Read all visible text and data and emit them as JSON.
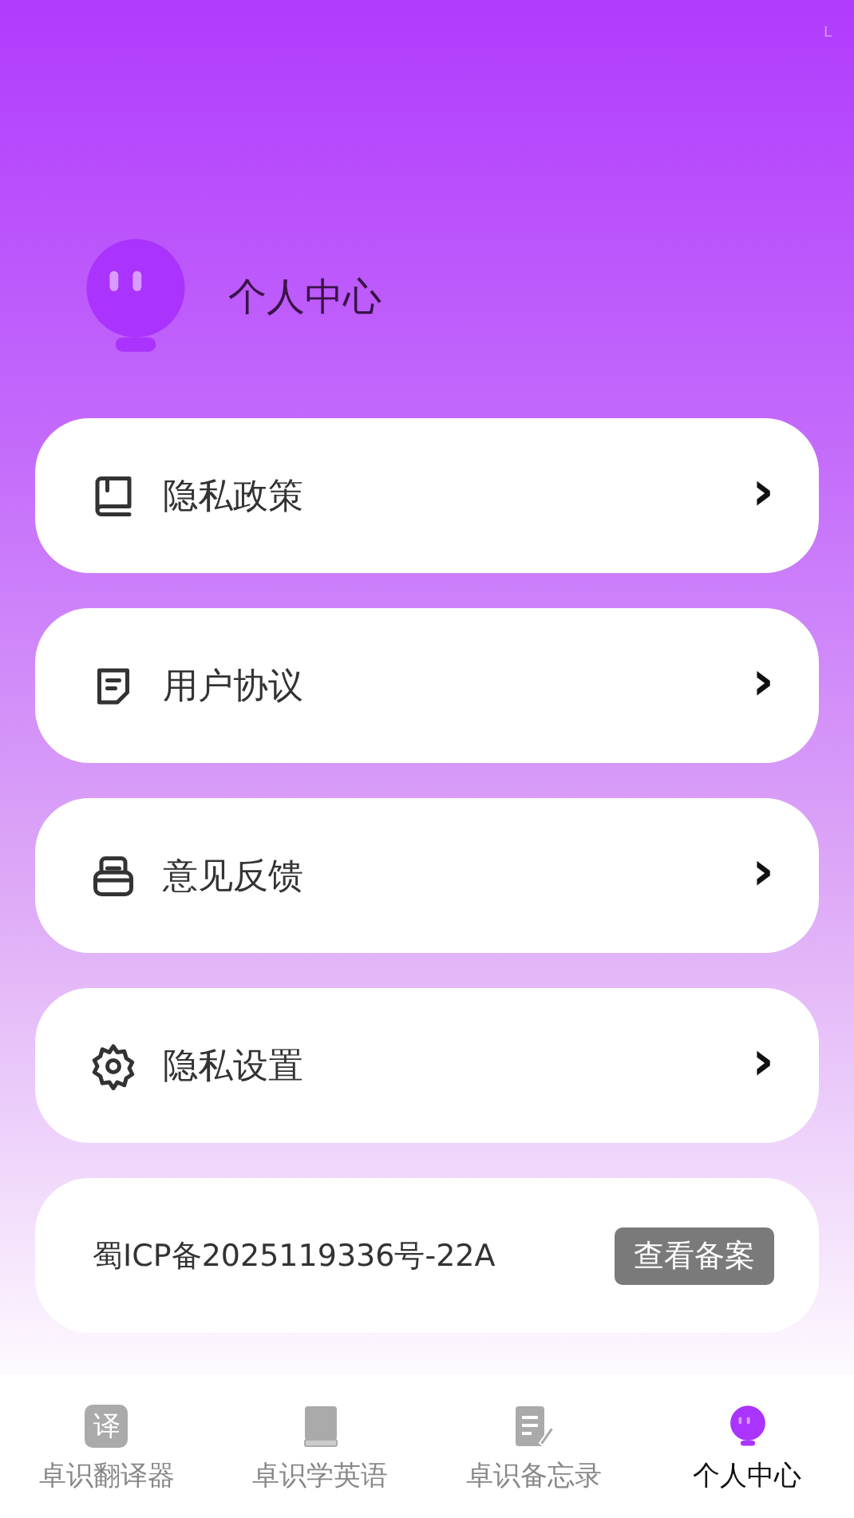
{
  "corner_mark": "L",
  "profile": {
    "title": "个人中心"
  },
  "menu": [
    {
      "kind": "book",
      "label": "隐私政策",
      "chevron": "›"
    },
    {
      "kind": "note",
      "label": "用户协议",
      "chevron": "›"
    },
    {
      "kind": "inbox",
      "label": "意见反馈",
      "chevron": "›"
    },
    {
      "kind": "gear",
      "label": "隐私设置",
      "chevron": "›"
    }
  ],
  "icp": {
    "text": "蜀ICP备2025119336号-22A",
    "button": "查看备案"
  },
  "tabs": [
    {
      "kind": "translate",
      "icon_text": "译",
      "label": "卓识翻译器",
      "selected": false
    },
    {
      "kind": "book",
      "label": "卓识学英语",
      "selected": false
    },
    {
      "kind": "memo",
      "label": "卓识备忘录",
      "selected": false
    },
    {
      "kind": "avatar",
      "label": "个人中心",
      "selected": true
    }
  ]
}
